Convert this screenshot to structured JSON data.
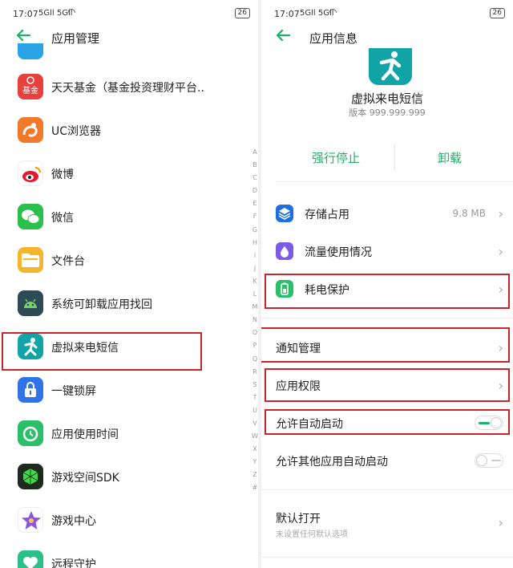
{
  "status_bar": {
    "time": "17:07",
    "signal": "5Gll 5Gll",
    "battery": "26"
  },
  "left": {
    "title": "应用管理",
    "apps": [
      {
        "name": "天天基金（基金投资理财平台..",
        "icon": "jijin-icon",
        "color": "#e8403b"
      },
      {
        "name": "UC浏览器",
        "icon": "uc-browser-icon",
        "color": "#f07a2a"
      },
      {
        "name": "微博",
        "icon": "weibo-icon",
        "color": "#ffffff"
      },
      {
        "name": "微信",
        "icon": "wechat-icon",
        "color": "#2bc04c"
      },
      {
        "name": "文件台",
        "icon": "folder-icon",
        "color": "#f6b62c"
      },
      {
        "name": "系统可卸载应用找回",
        "icon": "android-icon",
        "color": "#2e4a54"
      },
      {
        "name": "虚拟来电短信",
        "icon": "running-man-icon",
        "color": "#10a4a7"
      },
      {
        "name": "一键锁屏",
        "icon": "lock-icon",
        "color": "#2f73e8"
      },
      {
        "name": "应用使用时间",
        "icon": "clock-icon",
        "color": "#2bbf6a"
      },
      {
        "name": "游戏空间SDK",
        "icon": "cube-icon",
        "color": "#1d2a1d"
      },
      {
        "name": "游戏中心",
        "icon": "star-icon",
        "color": "#ffffff"
      },
      {
        "name": "远程守护",
        "icon": "heart-icon",
        "color": "#2bbf8a"
      }
    ],
    "alphabet": [
      "A",
      "B",
      "C",
      "D",
      "E",
      "F",
      "G",
      "H",
      "I",
      "J",
      "K",
      "L",
      "M",
      "N",
      "O",
      "P",
      "Q",
      "R",
      "S",
      "T",
      "U",
      "V",
      "W",
      "X",
      "Y",
      "Z",
      "#"
    ]
  },
  "right": {
    "title": "应用信息",
    "app_name": "虚拟来电短信",
    "version": "版本 999.999.999",
    "force_stop": "强行停止",
    "uninstall": "卸载",
    "storage": {
      "label": "存储占用",
      "value": "9.8 MB"
    },
    "data_usage": {
      "label": "流量使用情况"
    },
    "battery": {
      "label": "耗电保护"
    },
    "notifications": {
      "label": "通知管理"
    },
    "permissions": {
      "label": "应用权限"
    },
    "auto_start": {
      "label": "允许自动启动",
      "on": true
    },
    "other_auto_start": {
      "label": "允许其他应用自动启动",
      "on": false
    },
    "default_open": {
      "label": "默认打开",
      "sub": "未设置任何默认选项"
    }
  },
  "colors": {
    "accent": "#1fb167",
    "highlight": "#c9252c"
  }
}
